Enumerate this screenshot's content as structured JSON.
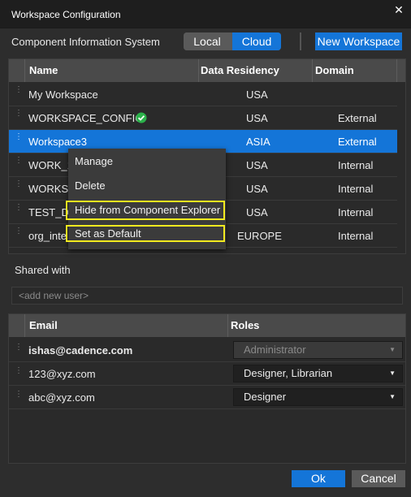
{
  "window": {
    "title": "Workspace Configuration",
    "close_glyph": "✕"
  },
  "toolbar": {
    "system_label": "Component Information System",
    "local_label": "Local",
    "cloud_label": "Cloud",
    "selected_mode": "Cloud",
    "new_workspace_label": "New Workspace"
  },
  "workspace_table": {
    "columns": [
      "Name",
      "Data Residency",
      "Domain"
    ],
    "rows": [
      {
        "name": "My Workspace",
        "residency": "USA",
        "domain": ""
      },
      {
        "name": "WORKSPACE_CONFIG",
        "residency": "USA",
        "domain": "External",
        "verified_icon": "check-circle-icon"
      },
      {
        "name": "Workspace3",
        "residency": "ASIA",
        "domain": "External",
        "selected": true
      },
      {
        "name": "WORK_1",
        "residency": "USA",
        "domain": "Internal"
      },
      {
        "name": "WORKSP",
        "residency": "USA",
        "domain": "Internal"
      },
      {
        "name": "TEST_DE",
        "residency": "USA",
        "domain": "Internal"
      },
      {
        "name": "org_inte",
        "residency": "EUROPE",
        "domain": "Internal"
      }
    ]
  },
  "context_menu": {
    "items": [
      "Manage",
      "Delete",
      "Hide from Component Explorer",
      "Set as Default"
    ],
    "highlighted_items": [
      "Hide from Component Explorer",
      "Set as Default"
    ],
    "highlight_color": "#f2ea1f"
  },
  "sharing": {
    "label": "Shared with",
    "add_user_placeholder": "<add new user>"
  },
  "user_table": {
    "columns": [
      "Email",
      "Roles"
    ],
    "rows": [
      {
        "email": "ishas@cadence.com",
        "role": "Administrator",
        "bold": true,
        "disabled": true
      },
      {
        "email": "123@xyz.com",
        "role": "Designer, Librarian",
        "disabled": false
      },
      {
        "email": "abc@xyz.com",
        "role": "Designer",
        "disabled": false
      }
    ]
  },
  "footer": {
    "ok_label": "Ok",
    "cancel_label": "Cancel"
  },
  "colors": {
    "accent": "#1475d8",
    "background": "#2d2d2d",
    "header": "#4a4a4a"
  }
}
